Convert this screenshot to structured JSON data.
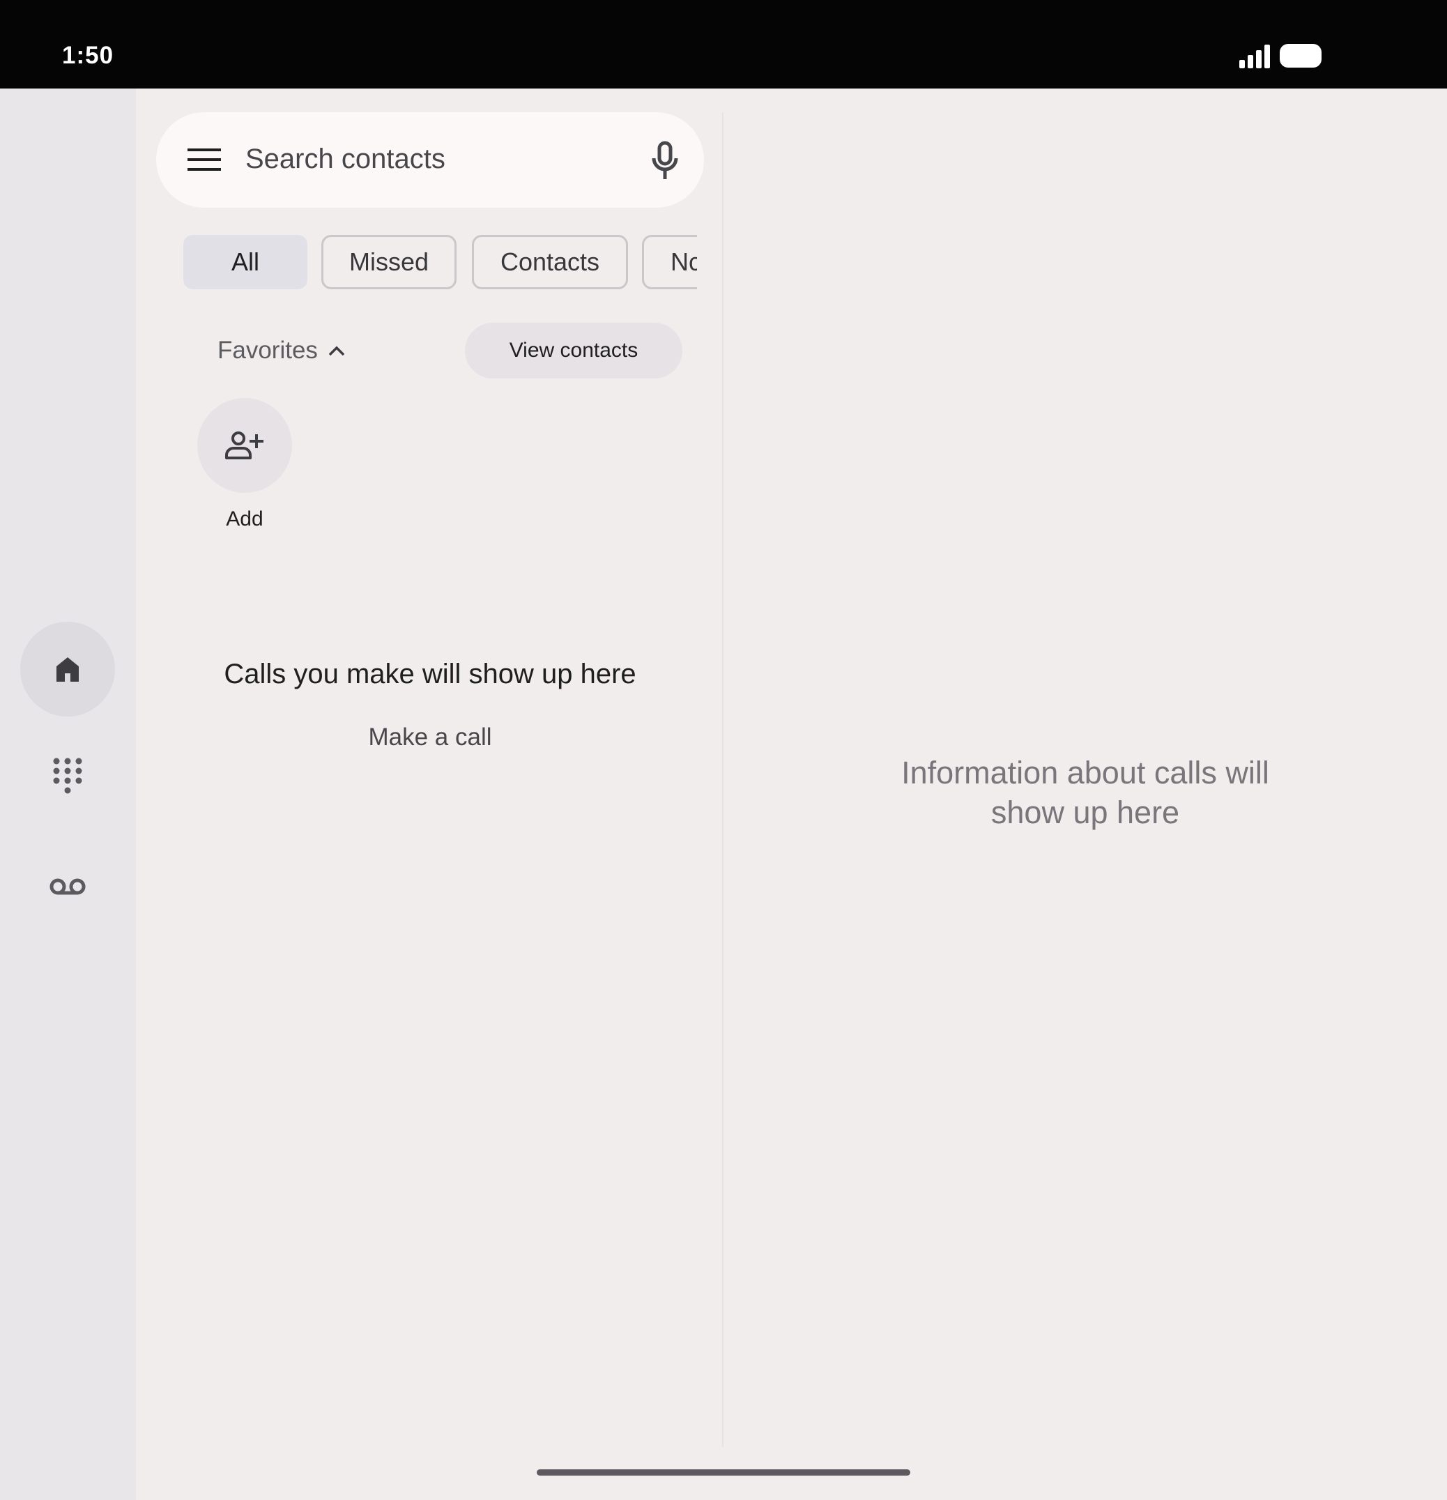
{
  "status_bar": {
    "time": "1:50"
  },
  "search": {
    "placeholder": "Search contacts"
  },
  "filters": {
    "all": "All",
    "missed": "Missed",
    "contacts": "Contacts",
    "non_spam": "Nc"
  },
  "favorites": {
    "label": "Favorites",
    "view_contacts": "View contacts",
    "add_label": "Add"
  },
  "call_log": {
    "empty_title": "Calls you make will show up here",
    "make_call": "Make a call"
  },
  "detail_pane": {
    "empty_text": "Information about calls will show up here"
  },
  "icons": {
    "menu": "menu-icon",
    "mic": "mic-icon",
    "home": "home-icon",
    "keypad": "dialpad-icon",
    "voicemail": "voicemail-icon",
    "add_person": "person-add-icon",
    "chevron": "chevron-up-icon"
  }
}
